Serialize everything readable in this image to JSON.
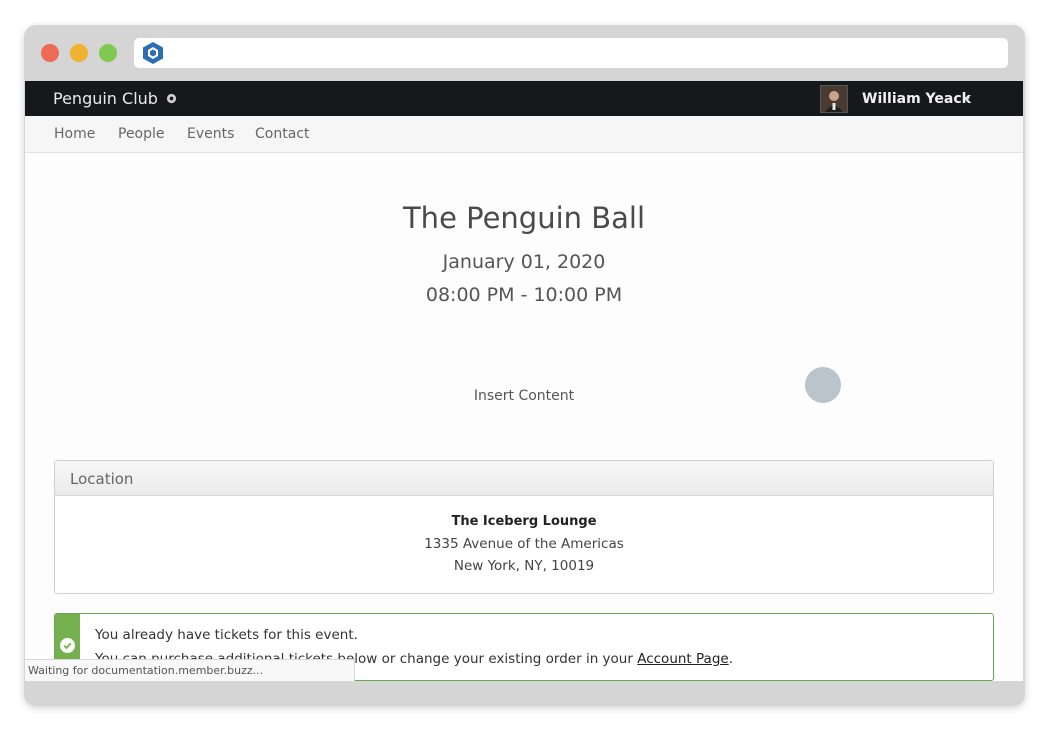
{
  "browser": {
    "logo_icon": "browser-logo-icon"
  },
  "site": {
    "brand": "Penguin Club",
    "user_name": "William Yeack",
    "nav": [
      "Home",
      "People",
      "Events",
      "Contact"
    ]
  },
  "event": {
    "title": "The Penguin Ball",
    "date": "January 01, 2020",
    "time": "08:00 PM - 10:00 PM",
    "placeholder": "Insert Content"
  },
  "location": {
    "heading": "Location",
    "venue": "The Iceberg Lounge",
    "address_line1": "1335 Avenue of the Americas",
    "address_line2": "New York, NY, 10019"
  },
  "alert": {
    "line1": "You already have tickets for this event.",
    "line2_prefix": "You can purchase additional tickets below or change your existing order in your",
    "link": "Account Page",
    "line2_suffix": "."
  },
  "status_bar": "Waiting for documentation.member.buzz...",
  "colors": {
    "navbar": "#16191c",
    "success": "#76b04e"
  }
}
